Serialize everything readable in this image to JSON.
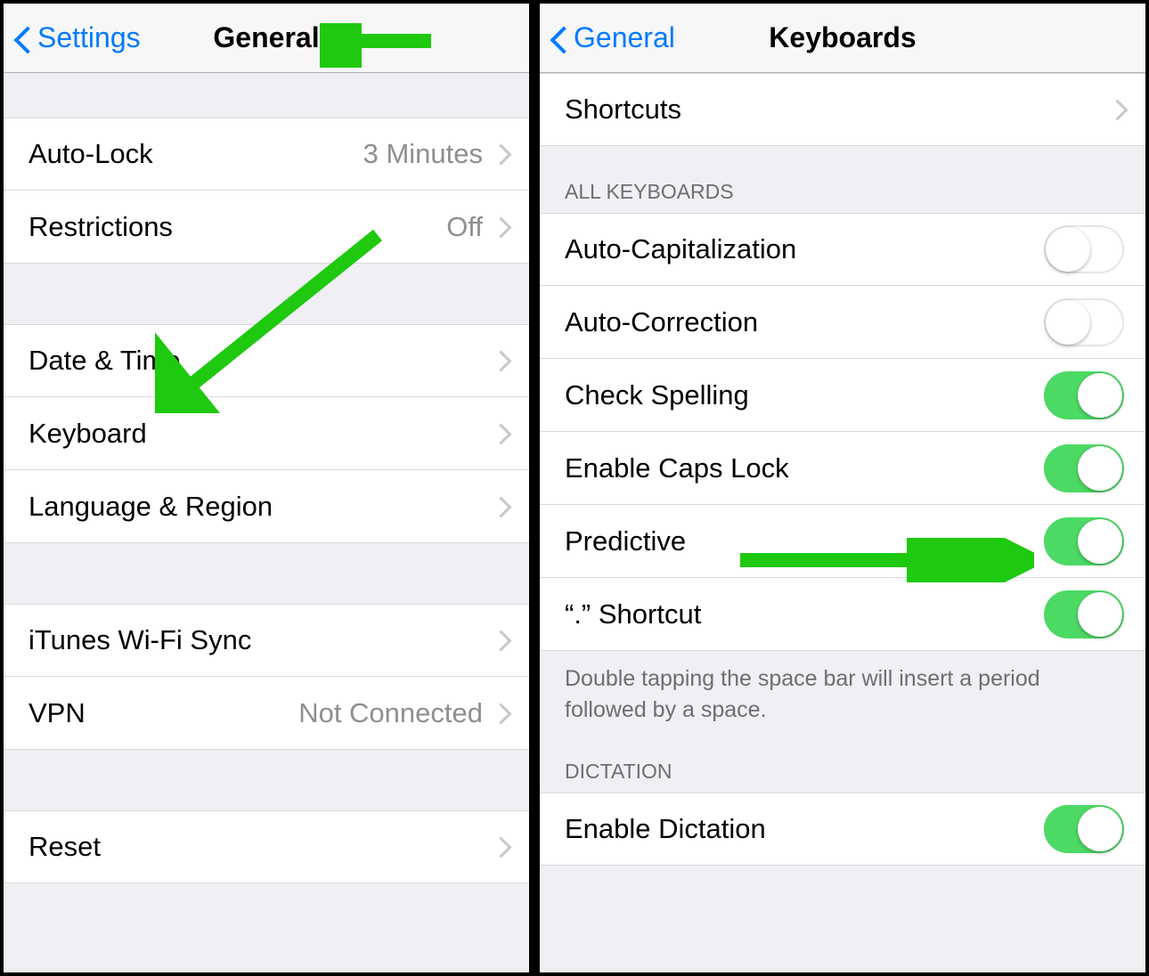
{
  "left": {
    "back_label": "Settings",
    "title": "General",
    "rows": {
      "autolock": {
        "label": "Auto-Lock",
        "value": "3 Minutes"
      },
      "restrictions": {
        "label": "Restrictions",
        "value": "Off"
      },
      "datetime": {
        "label": "Date & Time"
      },
      "keyboard": {
        "label": "Keyboard"
      },
      "language": {
        "label": "Language & Region"
      },
      "itunes": {
        "label": "iTunes Wi-Fi Sync"
      },
      "vpn": {
        "label": "VPN",
        "value": "Not Connected"
      },
      "reset": {
        "label": "Reset"
      }
    }
  },
  "right": {
    "back_label": "General",
    "title": "Keyboards",
    "shortcuts": {
      "label": "Shortcuts"
    },
    "section_all": "ALL KEYBOARDS",
    "toggles": {
      "autocap": {
        "label": "Auto-Capitalization",
        "on": false
      },
      "autocorrect": {
        "label": "Auto-Correction",
        "on": false
      },
      "spelling": {
        "label": "Check Spelling",
        "on": true
      },
      "capslock": {
        "label": "Enable Caps Lock",
        "on": true
      },
      "predictive": {
        "label": "Predictive",
        "on": true
      },
      "dotshortcut": {
        "label": "“.” Shortcut",
        "on": true
      },
      "dictation": {
        "label": "Enable Dictation",
        "on": true
      }
    },
    "footer": "Double tapping the space bar will insert a period followed by a space.",
    "section_dictation": "DICTATION"
  },
  "colors": {
    "tint": "#007aff",
    "switch_on": "#4cd964",
    "arrow": "#1fc90f"
  }
}
